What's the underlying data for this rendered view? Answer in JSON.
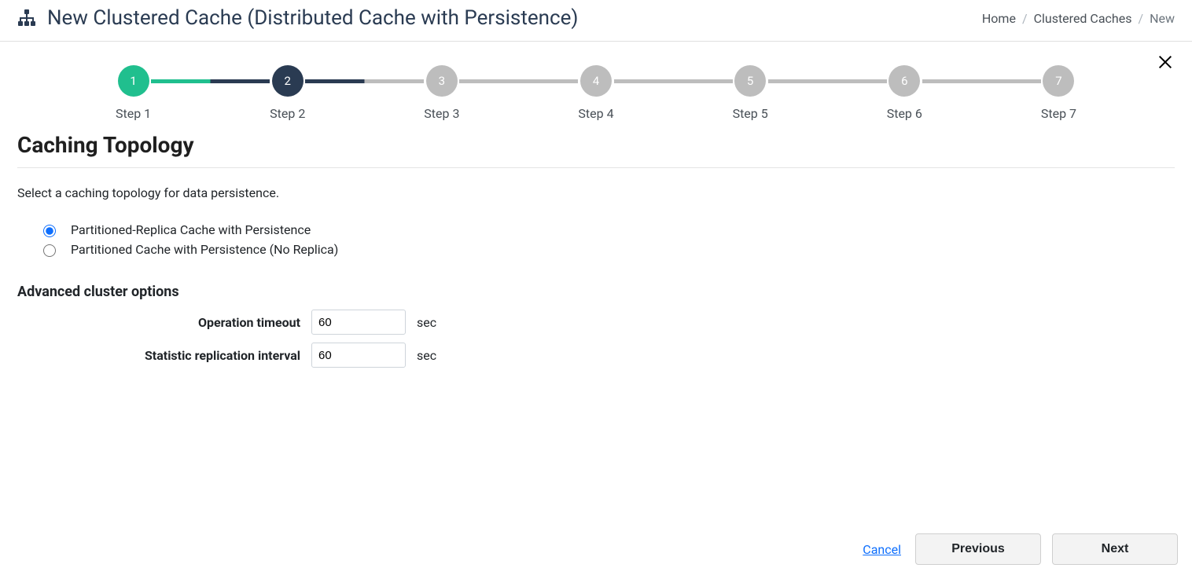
{
  "header": {
    "title": "New Clustered Cache (Distributed Cache with Persistence)"
  },
  "breadcrumb": {
    "home": "Home",
    "parent": "Clustered Caches",
    "current": "New"
  },
  "stepper": {
    "items": [
      {
        "num": "1",
        "label": "Step 1",
        "state": "completed"
      },
      {
        "num": "2",
        "label": "Step 2",
        "state": "active"
      },
      {
        "num": "3",
        "label": "Step 3",
        "state": "pending"
      },
      {
        "num": "4",
        "label": "Step 4",
        "state": "pending"
      },
      {
        "num": "5",
        "label": "Step 5",
        "state": "pending"
      },
      {
        "num": "6",
        "label": "Step 6",
        "state": "pending"
      },
      {
        "num": "7",
        "label": "Step 7",
        "state": "pending"
      }
    ]
  },
  "page": {
    "title": "Caching Topology",
    "description": "Select a caching topology for data persistence.",
    "radios": {
      "option1": "Partitioned-Replica Cache with Persistence",
      "option2": "Partitioned Cache with Persistence (No Replica)",
      "selected": "option1"
    },
    "advanced_title": "Advanced cluster options",
    "operation_timeout": {
      "label": "Operation timeout",
      "value": "60",
      "unit": "sec"
    },
    "stat_interval": {
      "label": "Statistic replication interval",
      "value": "60",
      "unit": "sec"
    }
  },
  "footer": {
    "cancel": "Cancel",
    "previous": "Previous",
    "next": "Next"
  }
}
